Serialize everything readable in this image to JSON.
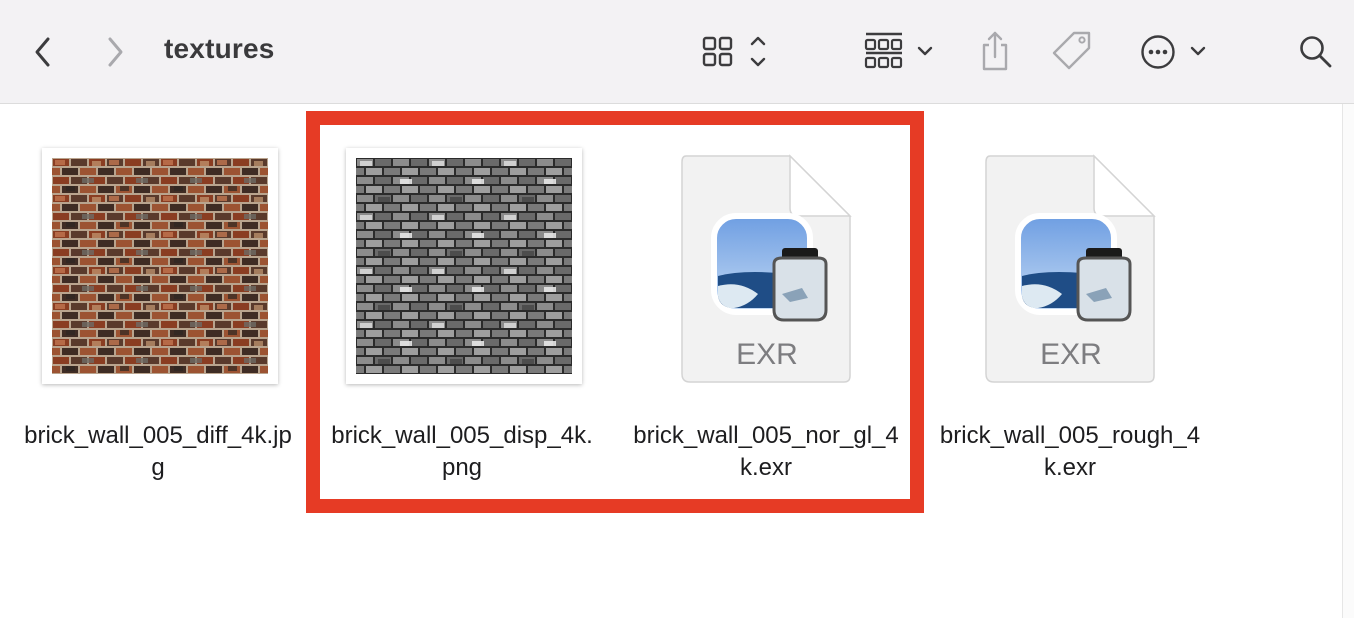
{
  "window": {
    "title": "textures"
  },
  "toolbar": {
    "back_icon": "chevron-left-icon",
    "forward_icon": "chevron-right-icon",
    "view_icon": "icon-grid-view-icon",
    "group_icon": "group-by-icon",
    "share_icon": "share-icon",
    "tag_icon": "tag-icon",
    "more_icon": "ellipsis-circle-icon",
    "search_icon": "search-icon"
  },
  "files": [
    {
      "name_line1": "brick_wall_005_diff_4k.jp",
      "name_line2": "g",
      "kind": "image-thumbnail"
    },
    {
      "name_line1": "brick_wall_005_disp_4k.",
      "name_line2": "png",
      "kind": "image-thumbnail"
    },
    {
      "name_line1": "brick_wall_005_nor_gl_4",
      "name_line2": "k.exr",
      "kind": "document-icon",
      "badge": "EXR"
    },
    {
      "name_line1": "brick_wall_005_rough_4",
      "name_line2": "k.exr",
      "kind": "document-icon",
      "badge": "EXR"
    }
  ],
  "colors": {
    "highlight": "#e63b25",
    "toolbar_bg": "#f3f2f4"
  }
}
